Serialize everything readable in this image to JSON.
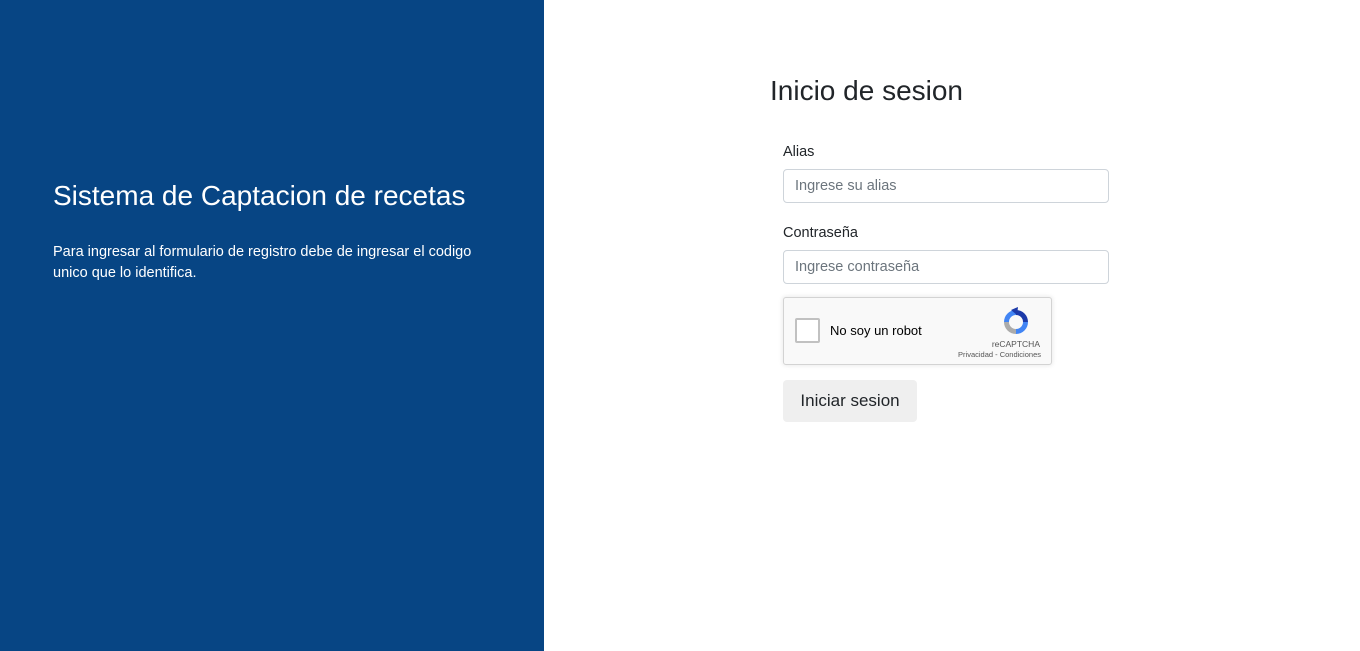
{
  "left": {
    "title": "Sistema de Captacion de recetas",
    "description": "Para ingresar al formulario de registro debe de ingresar el codigo unico que lo identifica.",
    "background": "#074584"
  },
  "form": {
    "title": "Inicio de sesion",
    "alias_label": "Alias",
    "alias_placeholder": "Ingrese su alias",
    "alias_value": "",
    "password_label": "Contraseña",
    "password_placeholder": "Ingrese contraseña",
    "password_value": "",
    "submit_label": "Iniciar sesion"
  },
  "recaptcha": {
    "label": "No soy un robot",
    "brand": "reCAPTCHA",
    "links": "Privacidad - Condiciones",
    "checked": false,
    "icon": "recaptcha-logo-icon"
  }
}
